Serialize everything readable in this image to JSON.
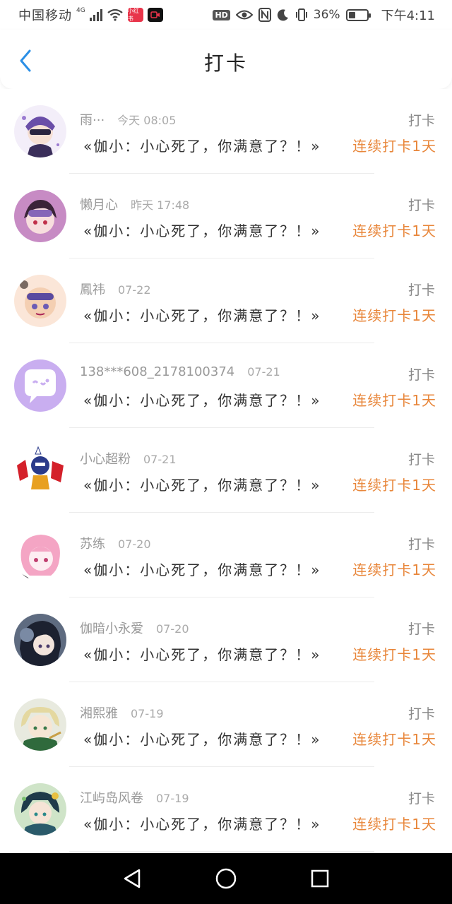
{
  "status_bar": {
    "carrier": "中国移动",
    "network": "4G",
    "app_badge_1": "小红书",
    "hd": "HD",
    "battery_percent": "36%",
    "battery_level": 0.36,
    "time": "下午4:11"
  },
  "header": {
    "title": "打卡",
    "back_icon": "chevron-left-icon",
    "accent_color": "#2b8fe6"
  },
  "checkins": [
    {
      "name": "雨···",
      "time": "今天 08:05",
      "tag": "打卡",
      "message": "«伽小：小心死了，你满意了？！»",
      "streak": "连续打卡1天",
      "avatar": "avatar-1"
    },
    {
      "name": "懒月心",
      "time": "昨天 17:48",
      "tag": "打卡",
      "message": "«伽小：小心死了，你满意了？！»",
      "streak": "连续打卡1天",
      "avatar": "avatar-2"
    },
    {
      "name": "鳳祎",
      "time": "07-22",
      "tag": "打卡",
      "message": "«伽小：小心死了，你满意了？！»",
      "streak": "连续打卡1天",
      "avatar": "avatar-3"
    },
    {
      "name": "138***608_2178100374",
      "time": "07-21",
      "tag": "打卡",
      "message": "«伽小：小心死了，你满意了？！»",
      "streak": "连续打卡1天",
      "avatar": "avatar-4"
    },
    {
      "name": "小心超粉",
      "time": "07-21",
      "tag": "打卡",
      "message": "«伽小：小心死了，你满意了？！»",
      "streak": "连续打卡1天",
      "avatar": "avatar-5"
    },
    {
      "name": "苏练",
      "time": "07-20",
      "tag": "打卡",
      "message": "«伽小：小心死了，你满意了？！»",
      "streak": "连续打卡1天",
      "avatar": "avatar-6"
    },
    {
      "name": "伽暗小永爱",
      "time": "07-20",
      "tag": "打卡",
      "message": "«伽小：小心死了，你满意了？！»",
      "streak": "连续打卡1天",
      "avatar": "avatar-7"
    },
    {
      "name": "湘熙雅",
      "time": "07-19",
      "tag": "打卡",
      "message": "«伽小：小心死了，你满意了？！»",
      "streak": "连续打卡1天",
      "avatar": "avatar-8"
    },
    {
      "name": "江屿岛风卷",
      "time": "07-19",
      "tag": "打卡",
      "message": "«伽小：小心死了，你满意了？！»",
      "streak": "连续打卡1天",
      "avatar": "avatar-9"
    }
  ],
  "colors": {
    "streak": "#e8863a",
    "divider": "#ececec",
    "navbar": "#000000"
  },
  "navbar": {
    "back": "triangle-back-icon",
    "home": "circle-home-icon",
    "recents": "square-recents-icon"
  }
}
